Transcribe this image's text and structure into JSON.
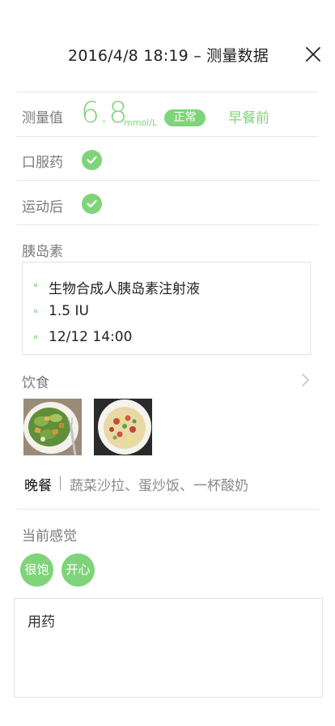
{
  "header": {
    "title": "2016/4/8  18:19 – 测量数据",
    "close_icon": "close-icon"
  },
  "measurement": {
    "label": "测量值",
    "value": "6.8",
    "unit": "mmol/L",
    "status": "正常",
    "timing": "早餐前"
  },
  "oral_medicine": {
    "label": "口服药",
    "checked": true
  },
  "after_exercise": {
    "label": "运动后",
    "checked": true
  },
  "insulin": {
    "label": "胰岛素",
    "items": [
      "生物合成人胰岛素注射液",
      "1.5 IU",
      "12/12  14:00"
    ]
  },
  "diet": {
    "label": "饮食",
    "chevron_icon": "chevron-right-icon",
    "meal": "晚餐",
    "items": "蔬菜沙拉、蛋炒饭、一杯酸奶"
  },
  "feeling": {
    "label": "当前感觉",
    "chips": [
      "很饱",
      "开心"
    ]
  },
  "notes": {
    "text": "用药"
  },
  "colors": {
    "accent": "#7fd47a",
    "label": "#7a7a7a",
    "divider": "#e8e8e8"
  }
}
